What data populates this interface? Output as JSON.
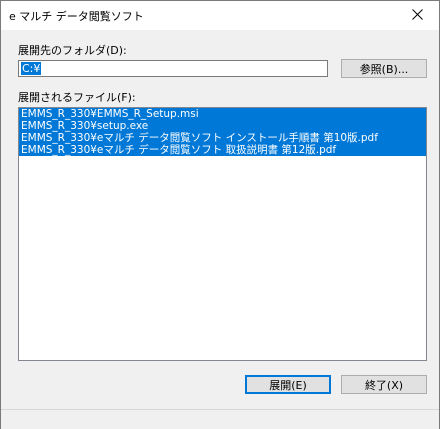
{
  "window": {
    "title": "e マルチ データ閲覧ソフト"
  },
  "folder": {
    "label": "展開先のフォルダ(D):",
    "value": "C:¥",
    "browse_label": "参照(B)..."
  },
  "files": {
    "label": "展開されるファイル(F):",
    "items": [
      "EMMS_R_330¥EMMS_R_Setup.msi",
      "EMMS_R_330¥setup.exe",
      "EMMS_R_330¥eマルチ データ閲覧ソフト インストール手順書 第10版.pdf",
      "EMMS_R_330¥eマルチ データ閲覧ソフト 取扱説明書 第12版.pdf"
    ]
  },
  "buttons": {
    "extract_label": "展開(E)",
    "exit_label": "終了(X)"
  },
  "colors": {
    "accent": "#0078d7"
  }
}
